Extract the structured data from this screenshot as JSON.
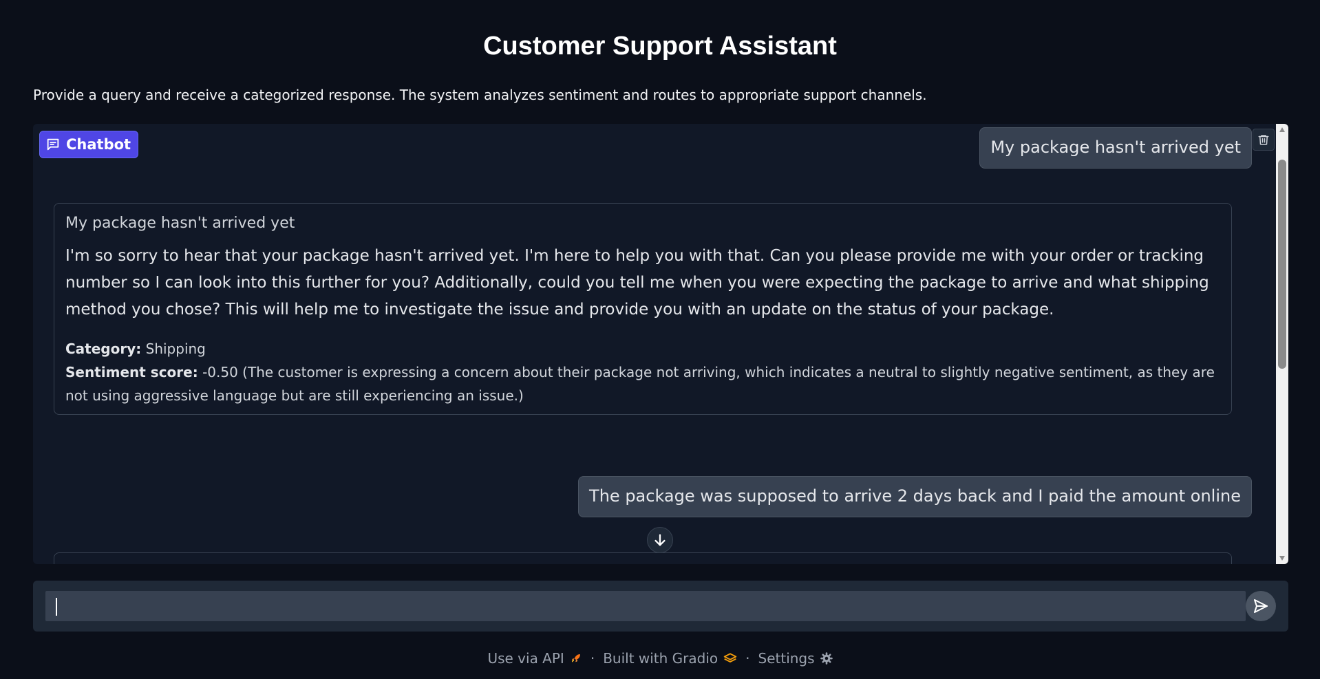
{
  "header": {
    "title": "Customer Support Assistant",
    "description": "Provide a query and receive a categorized response. The system analyzes sentiment and routes to appropriate support channels."
  },
  "chatbot": {
    "label": "Chatbot",
    "messages": [
      {
        "role": "user",
        "text": "My package hasn't arrived yet"
      },
      {
        "role": "assistant",
        "query": "My package hasn't arrived yet",
        "answer": "I'm so sorry to hear that your package hasn't arrived yet. I'm here to help you with that. Can you please provide me with your order or tracking number so I can look into this further for you? Additionally, could you tell me when you were expecting the package to arrive and what shipping method you chose? This will help me to investigate the issue and provide you with an update on the status of your package.",
        "category_label": "Category:",
        "category": "Shipping",
        "sentiment_label": "Sentiment score:",
        "sentiment": "-0.50 (The customer is expressing a concern about their package not arriving, which indicates a neutral to slightly negative sentiment, as they are not using aggressive language but are still experiencing an issue.)"
      },
      {
        "role": "user",
        "text": "The package was supposed to arrive 2 days back and I paid the amount online"
      }
    ]
  },
  "input": {
    "value": "",
    "placeholder": ""
  },
  "footer": {
    "api_label": "Use via API",
    "separator": "·",
    "built_label": "Built with Gradio",
    "settings_label": "Settings"
  },
  "colors": {
    "background": "#0b0f19",
    "panel": "#111827",
    "accent": "#4f46e5",
    "user_bubble": "#374151"
  }
}
